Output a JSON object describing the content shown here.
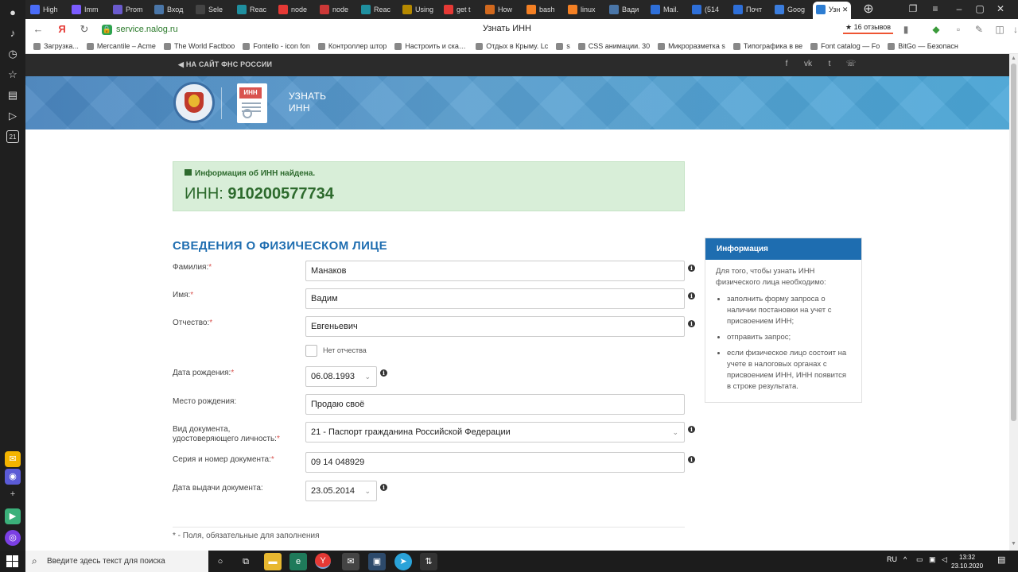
{
  "browser": {
    "tabs": [
      {
        "label": "High",
        "color": "#4a6cf7"
      },
      {
        "label": "Imm",
        "color": "#7b5cff"
      },
      {
        "label": "Prom",
        "color": "#6a5acd"
      },
      {
        "label": "Вход",
        "color": "#4a76a8"
      },
      {
        "label": "Sele",
        "color": "#444"
      },
      {
        "label": "Reac",
        "color": "#1f8f9f"
      },
      {
        "label": "node",
        "color": "#e53935"
      },
      {
        "label": "node",
        "color": "#cb3837"
      },
      {
        "label": "Reac",
        "color": "#1f8f9f"
      },
      {
        "label": "Using",
        "color": "#b58900"
      },
      {
        "label": "get t",
        "color": "#e53935"
      },
      {
        "label": "How",
        "color": "#d2691e"
      },
      {
        "label": "bash",
        "color": "#f48024"
      },
      {
        "label": "linux",
        "color": "#f48024"
      },
      {
        "label": "Вади",
        "color": "#4a76a8"
      },
      {
        "label": "Mail.",
        "color": "#2e6fd8"
      },
      {
        "label": "(514",
        "color": "#2e6fd8"
      },
      {
        "label": "Почт",
        "color": "#2e6fd8"
      },
      {
        "label": "Goog",
        "color": "#3b7ddd"
      },
      {
        "label": "Узн",
        "color": "#2d7dd2"
      }
    ],
    "url": "service.nalog.ru",
    "page_title": "Узнать ИНН",
    "reviews": "16 отзывов",
    "bookmarks": [
      "Загрузка...",
      "Mercantile – Acme",
      "The World Factboo",
      "Fontello - icon fon",
      "Контроллер штор",
      "Настроить и скачат",
      "Отдых в Крыму. Lc",
      "s",
      "CSS анимации. 30",
      "Микроразметка s",
      "Типографика в ве",
      "Font catalog — Fo",
      "BitGo — Безопасн"
    ]
  },
  "site": {
    "back_link": "НА САЙТ ФНС РОССИИ",
    "social": [
      "f",
      "vk",
      "t",
      "☏"
    ],
    "banner_title_line1": "УЗНАТЬ",
    "banner_title_line2": "ИНН",
    "doc_badge": "ИНН"
  },
  "result": {
    "heading": "Информация об ИНН найдена.",
    "inn_label": "ИНН:",
    "inn_value": "910200577734"
  },
  "form": {
    "section_title": "СВЕДЕНИЯ О ФИЗИЧЕСКОМ ЛИЦЕ",
    "surname_label": "Фамилия:",
    "surname_value": "Манаков",
    "name_label": "Имя:",
    "name_value": "Вадим",
    "patronymic_label": "Отчество:",
    "patronymic_value": "Евгеньевич",
    "no_patronymic_label": "Нет отчества",
    "birthdate_label": "Дата рождения:",
    "birthdate_value": "06.08.1993",
    "birthplace_label": "Место рождения:",
    "birthplace_value": "Продаю своё",
    "doctype_label_1": "Вид документа,",
    "doctype_label_2": "удостоверяющего личность:",
    "doctype_value": "21 - Паспорт гражданина Российской Федерации",
    "docnum_label": "Серия и номер документа:",
    "docnum_value": "09 14 048929",
    "issue_date_label": "Дата выдачи документа:",
    "issue_date_value": "23.05.2014",
    "required_mark": "*",
    "footnote": "* - Поля, обязательные для заполнения"
  },
  "info_panel": {
    "title": "Информация",
    "intro": "Для того, чтобы узнать ИНН физического лица необходимо:",
    "items": [
      "заполнить форму запроса о наличии постановки на учет с присвоением ИНН;",
      "отправить запрос;",
      "если физическое лицо состоит на учете в налоговых органах с присвоением ИНН, ИНН появится в строке результата."
    ]
  },
  "taskbar": {
    "search_placeholder": "Введите здесь текст для поиска",
    "lang": "RU",
    "time": "13:32",
    "date": "23.10.2020"
  },
  "colors": {
    "accent": "#1e6db0",
    "success_bg": "#d8eed8",
    "success_text": "#2d6a2d",
    "required": "#d9534f"
  }
}
